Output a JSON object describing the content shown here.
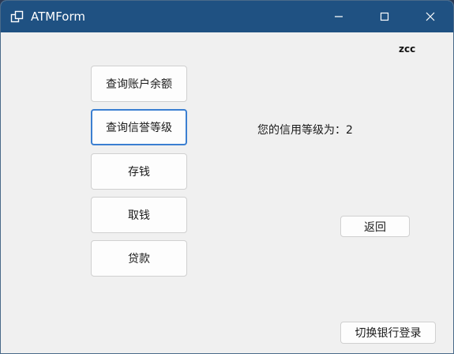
{
  "window": {
    "title": "ATMForm",
    "titlebar_color": "#1f5182",
    "icons": [
      "app-icon",
      "minimize-icon",
      "maximize-icon",
      "close-icon"
    ]
  },
  "user": {
    "name": "zcc"
  },
  "side_buttons": [
    {
      "label": "查询账户余额"
    },
    {
      "label": "查询信誉等级"
    },
    {
      "label": "存钱"
    },
    {
      "label": "取钱"
    },
    {
      "label": "贷款"
    }
  ],
  "focused_button": "查询信誉等级",
  "focus_color": "#3b7fd1",
  "info": {
    "credit_prefix": "您的信用等级为：",
    "credit_value": "2"
  },
  "actions": {
    "back_label": "返回",
    "switch_bank_label": "切换银行登录"
  }
}
